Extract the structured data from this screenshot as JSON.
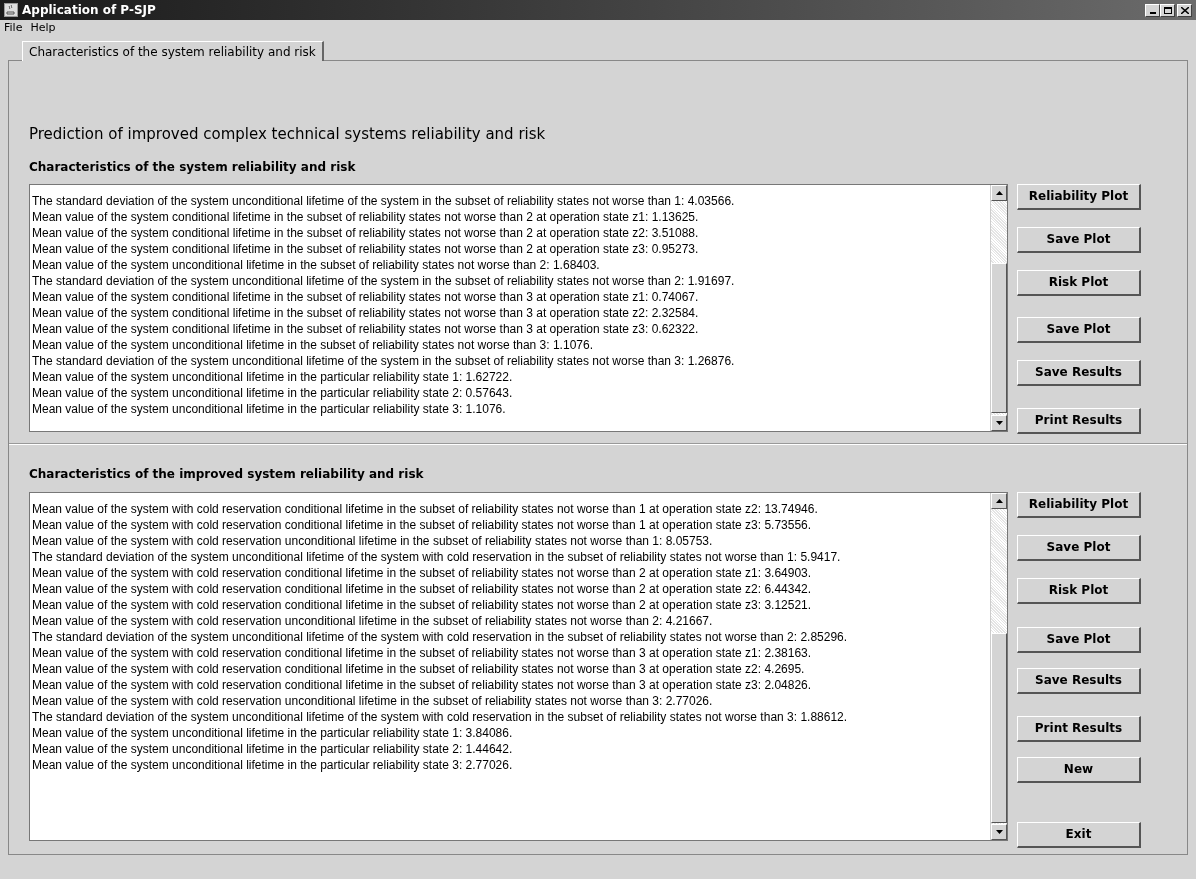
{
  "window": {
    "title": "Application of P-SJP"
  },
  "menu": [
    "File",
    "Help"
  ],
  "tabs": [
    {
      "label": "Characteristics of the system reliability and risk",
      "selected": true
    }
  ],
  "heading": "Prediction of improved complex technical systems reliability and risk",
  "sections": [
    {
      "title": "Characteristics of the system reliability and risk",
      "lines": [
        "The standard deviation of the system unconditional lifetime of the system in the subset of reliability states not worse than 1: 4.03566.",
        "Mean value of the system conditional lifetime in the subset of reliability states not worse than 2 at operation state z1: 1.13625.",
        "Mean value of the system conditional lifetime in the subset of reliability states not worse than 2 at operation state z2: 3.51088.",
        "Mean value of the system conditional lifetime in the subset of reliability states not worse than 2 at operation state z3: 0.95273.",
        "Mean value of the system unconditional lifetime in the subset of reliability states not worse than 2: 1.68403.",
        "The standard deviation of the system unconditional lifetime of the system in the subset of reliability states not worse than 2: 1.91697.",
        "Mean value of the system conditional lifetime in the subset of reliability states not worse than 3 at operation state z1: 0.74067.",
        "Mean value of the system conditional lifetime in the subset of reliability states not worse than 3 at operation state z2: 2.32584.",
        "Mean value of the system conditional lifetime in the subset of reliability states not worse than 3 at operation state z3: 0.62322.",
        "Mean value of the system unconditional lifetime in the subset of reliability states not worse than 3: 1.1076.",
        "The standard deviation of the system unconditional lifetime of the system in the subset of reliability states not worse than 3: 1.26876.",
        "Mean value of the system unconditional lifetime in the particular reliability state 1: 1.62722.",
        "Mean value of the system unconditional lifetime in the particular reliability state 2: 0.57643.",
        "Mean value of the system unconditional lifetime in the particular reliability state 3: 1.1076."
      ],
      "buttons": [
        "Reliability Plot",
        "Save Plot",
        "Risk Plot",
        "Save Plot",
        "Save Results",
        "Print Results"
      ]
    },
    {
      "title": "Characteristics of the improved system reliability and risk",
      "lines": [
        "Mean value of the system with cold reservation conditional lifetime in the subset of reliability states not worse than 1 at operation state z2: 13.74946.",
        "Mean value of the system with cold reservation conditional lifetime in the subset of reliability states not worse than 1 at operation state z3: 5.73556.",
        "Mean value of the system with cold reservation unconditional lifetime in the subset of reliability states not worse than 1: 8.05753.",
        "The standard deviation of the system unconditional lifetime of the system with cold reservation in the subset of reliability states not worse than 1: 5.9417.",
        "Mean value of the system with cold reservation conditional lifetime in the subset of reliability states not worse than 2 at operation state z1: 3.64903.",
        "Mean value of the system with cold reservation conditional lifetime in the subset of reliability states not worse than 2 at operation state z2: 6.44342.",
        "Mean value of the system with cold reservation conditional lifetime in the subset of reliability states not worse than 2 at operation state z3: 3.12521.",
        "Mean value of the system with cold reservation unconditional lifetime in the subset of reliability states not worse than 2: 4.21667.",
        "The standard deviation of the system unconditional lifetime of the system with cold reservation in the subset of reliability states not worse than 2: 2.85296.",
        "Mean value of the system with cold reservation conditional lifetime in the subset of reliability states not worse than 3 at operation state z1: 2.38163.",
        "Mean value of the system with cold reservation conditional lifetime in the subset of reliability states not worse than 3 at operation state z2: 4.2695.",
        "Mean value of the system with cold reservation conditional lifetime in the subset of reliability states not worse than 3 at operation state z3: 2.04826.",
        "Mean value of the system with cold reservation unconditional lifetime in the subset of reliability states not worse than 3: 2.77026.",
        "The standard deviation of the system unconditional lifetime of the system with cold reservation in the subset of reliability states not worse than 3: 1.88612.",
        "Mean value of the system unconditional lifetime in the particular reliability state 1: 3.84086.",
        "Mean value of the system unconditional lifetime in the particular reliability state 2: 1.44642.",
        "Mean value of the system unconditional lifetime in the particular reliability state 3: 2.77026."
      ],
      "buttons": [
        "Reliability Plot",
        "Save Plot",
        "Risk Plot",
        "Save Plot",
        "Save Results",
        "Print Results",
        "New",
        "Exit"
      ]
    }
  ]
}
